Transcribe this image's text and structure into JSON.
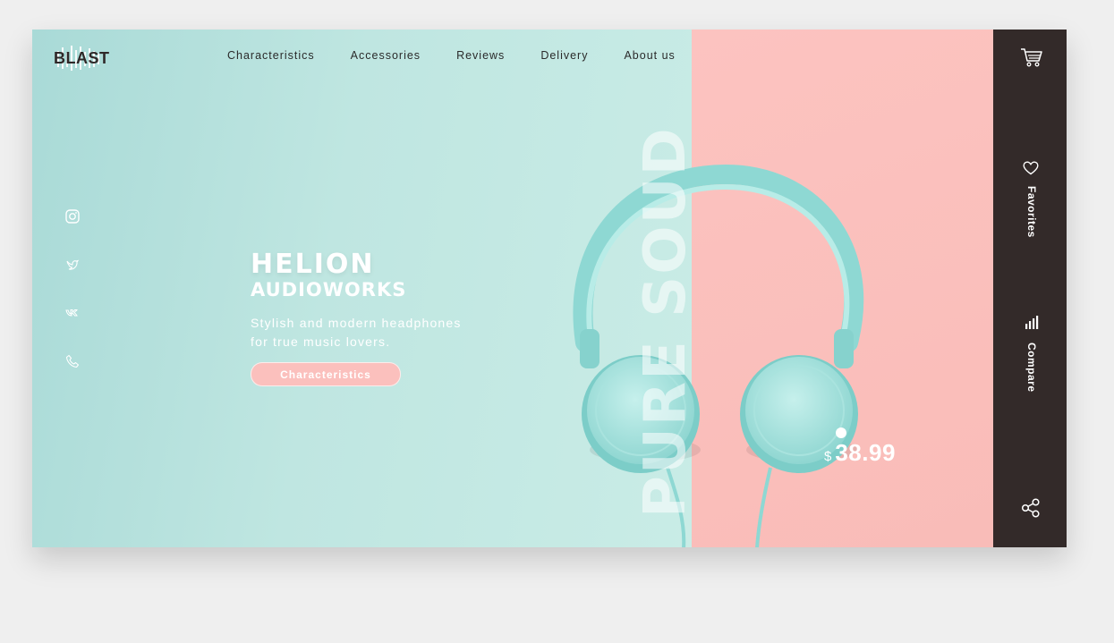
{
  "brand": {
    "logo_text": "BLAST"
  },
  "nav": {
    "items": [
      {
        "label": "Characteristics"
      },
      {
        "label": "Accessories"
      },
      {
        "label": "Reviews"
      },
      {
        "label": "Delivery"
      },
      {
        "label": "About us"
      }
    ]
  },
  "social": {
    "icons": [
      "instagram-icon",
      "twitter-icon",
      "vk-icon",
      "phone-icon"
    ]
  },
  "hero": {
    "title": "HELION",
    "subtitle": "AUDIOWORKS",
    "description": "Stylish and modern headphones for true music lovers.",
    "cta_label": "Characteristics"
  },
  "product": {
    "vertical_text": "PURE SOUD",
    "price_currency": "$",
    "price_amount": "38.99"
  },
  "sidebar": {
    "cart_icon": "cart-icon",
    "favorites_label": "Favorites",
    "compare_label": "Compare",
    "share_icon": "share-icon"
  },
  "colors": {
    "mint": "#bfe6e1",
    "pink": "#fbc0bd",
    "sidebar": "#332a29",
    "headphone": "#9fe0dc"
  }
}
